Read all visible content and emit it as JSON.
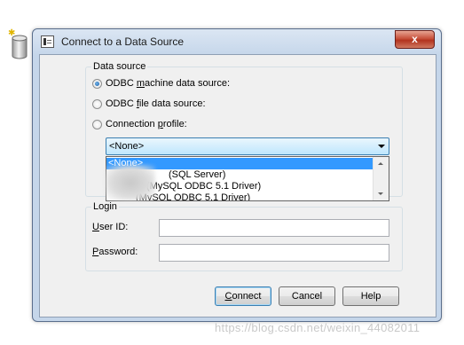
{
  "window": {
    "title": "Connect to a Data Source",
    "close_glyph": "x"
  },
  "data_source": {
    "label": "Data source",
    "odbc_machine": {
      "prefix": "ODBC ",
      "accel": "m",
      "suffix": "achine data source:",
      "checked": true
    },
    "odbc_file": {
      "prefix": "ODBC ",
      "accel": "f",
      "suffix": "ile data source:",
      "checked": false
    },
    "connection_profile": {
      "prefix": "Connection ",
      "accel": "p",
      "suffix": "rofile:",
      "checked": false
    }
  },
  "profile_combo": {
    "value": "<None>",
    "options": [
      "<None>",
      "(SQL Server)",
      "(MySQL ODBC 5.1 Driver)",
      "(MySQL ODBC 5.1 Driver)"
    ],
    "selected_index": 0
  },
  "login": {
    "label": "Login",
    "user_id": {
      "accel": "U",
      "suffix": "ser ID:",
      "value": ""
    },
    "password": {
      "accel": "P",
      "suffix": "assword:",
      "value": ""
    }
  },
  "buttons": {
    "connect": {
      "accel": "C",
      "suffix": "onnect"
    },
    "cancel": "Cancel",
    "help": "Help"
  },
  "watermark": "https://blog.csdn.net/weixin_44082011",
  "icons": {
    "title": "dialog-window-icon",
    "database": "database-cylinder-icon",
    "close": "close-icon",
    "dropdown": "chevron-down-icon"
  },
  "colors": {
    "selection": "#3399ff",
    "close_button": "#c7503a",
    "frame": "#c5d6ea"
  }
}
